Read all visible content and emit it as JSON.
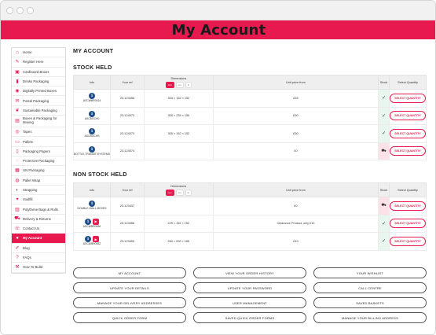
{
  "banner": {
    "title": "My Account"
  },
  "sidebar": {
    "items": [
      {
        "label": "Home",
        "icon": "home-icon",
        "glyph": "⌂"
      },
      {
        "label": "Register Here",
        "icon": "register-icon",
        "glyph": "✎"
      },
      {
        "label": "Cardboard Boxes",
        "icon": "box-icon",
        "glyph": "▣"
      },
      {
        "label": "Drinks Packaging",
        "icon": "bottle-icon",
        "glyph": "▮"
      },
      {
        "label": "Digitally Printed Boxes",
        "icon": "print-icon",
        "glyph": "◉"
      },
      {
        "label": "Postal Packaging",
        "icon": "mail-icon",
        "glyph": "✉"
      },
      {
        "label": "Sustainable Packaging",
        "icon": "leaf-icon",
        "glyph": "❦"
      },
      {
        "label": "Boxes & Packaging for Moving",
        "icon": "moving-icon",
        "glyph": "▤"
      },
      {
        "label": "Tapes",
        "icon": "tape-icon",
        "glyph": "◎"
      },
      {
        "label": "Pallets",
        "icon": "pallet-icon",
        "glyph": "▭"
      },
      {
        "label": "Packaging Papers",
        "icon": "paper-icon",
        "glyph": "▯"
      },
      {
        "label": "Protective Packaging",
        "icon": "bubble-icon",
        "glyph": "◌"
      },
      {
        "label": "UN Packaging",
        "icon": "un-icon",
        "glyph": "▦"
      },
      {
        "label": "Pallet Wrap",
        "icon": "wrap-icon",
        "glyph": "◍"
      },
      {
        "label": "Strapping",
        "icon": "strap-icon",
        "glyph": "◐"
      },
      {
        "label": "Voidfill",
        "icon": "voidfill-icon",
        "glyph": "✦"
      },
      {
        "label": "Polythene Bags & Rolls",
        "icon": "bag-icon",
        "glyph": "▥"
      },
      {
        "label": "Delivery & Returns",
        "icon": "truck-icon",
        "glyph": "⛟"
      },
      {
        "label": "Contact Us",
        "icon": "contact-icon",
        "glyph": "☏"
      },
      {
        "label": "My Account",
        "icon": "user-icon",
        "glyph": "●"
      },
      {
        "label": "Blog",
        "icon": "blog-icon",
        "glyph": "✐"
      },
      {
        "label": "FAQs",
        "icon": "faq-icon",
        "glyph": "?"
      },
      {
        "label": "How To Build",
        "icon": "build-icon",
        "glyph": "⚒"
      }
    ]
  },
  "main": {
    "page_title": "MY ACCOUNT",
    "stock_title": "STOCK HELD",
    "nonstock_title": "NON STOCK HELD",
    "columns": {
      "info": "Info",
      "ref": "Your ref",
      "dimensions": "Dimensions",
      "price": "Unit price from",
      "stock": "Stock",
      "select": "Select Quantity"
    },
    "dim_tabs": [
      "mm",
      "cm",
      "in"
    ],
    "select_label": "SELECT QUANTITY",
    "stock_rows": [
      {
        "code": "ASCWBR0014",
        "ref": "23-123456",
        "dims": "333 × 152 × 152",
        "price": "£25",
        "stock": "in"
      },
      {
        "code": "ASCBOCH0",
        "ref": "23-124573",
        "dims": "305 × 235 × 155",
        "price": "£50",
        "stock": "in"
      },
      {
        "code": "ASCBOCHS",
        "ref": "23-124573",
        "dims": "305 × 152 × 152",
        "price": "£50",
        "stock": "in"
      },
      {
        "code": "BOTTLE-TRANSIT-SYSTEMS",
        "ref": "23-124574",
        "dims": "",
        "price": "£0",
        "stock": "out"
      }
    ],
    "nonstock_rows": [
      {
        "code": "DOUBLE-WALL-BOXES",
        "ref": "23-123437",
        "dims": "",
        "price": "£0",
        "stock": "out",
        "video": false
      },
      {
        "code": "ASCWBR0836",
        "ref": "23-123456",
        "dims": "229 × 152 × 152",
        "price": "Clearance Product, only £10",
        "stock": "in",
        "video": true
      },
      {
        "code": "ASCWBR0832",
        "ref": "23-123459",
        "dims": "260 × 200 × 155",
        "price": "£10",
        "stock": "in",
        "video": true
      }
    ]
  },
  "actions": [
    "MY ACCOUNT",
    "VIEW YOUR ORDER HISTORY",
    "YOUR WISHLIST",
    "UPDATE YOUR DETAILS",
    "UPDATE YOUR PASSWORD",
    "CALL CENTRE",
    "MANAGE YOUR DELIVERY ADDRESSES",
    "USER MANAGEMENT",
    "SAVED BASKETS",
    "QUICK ORDER FORM",
    "SAVED QUICK ORDER FORMS",
    "MANAGE YOUR BILLING ADDRESS"
  ],
  "colors": {
    "accent": "#e8194f",
    "info_icon": "#1d4f8c",
    "in_stock": "#2e9a56"
  }
}
